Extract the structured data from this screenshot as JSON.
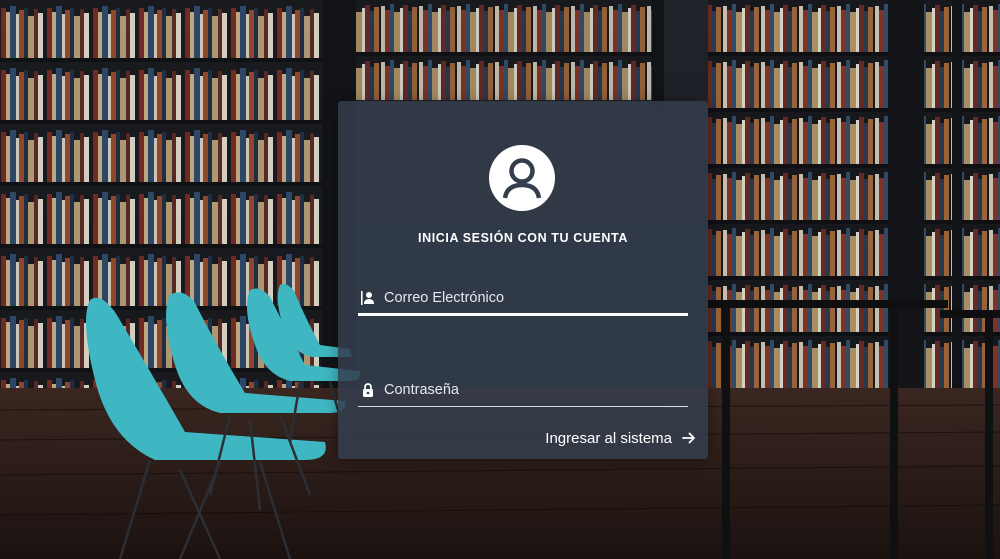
{
  "login": {
    "title": "INICIA SESIÓN CON TU CUENTA",
    "email_placeholder": "Correo Electrónico",
    "password_placeholder": "Contraseña",
    "submit_label": "Ingresar al sistema"
  },
  "icons": {
    "avatar": "user-circle-icon",
    "email": "user-icon",
    "password": "lock-icon",
    "submit": "arrow-right-icon"
  },
  "colors": {
    "card_background": "#343e4d",
    "accent": "#ffffff",
    "chair": "#3fb7c2"
  }
}
